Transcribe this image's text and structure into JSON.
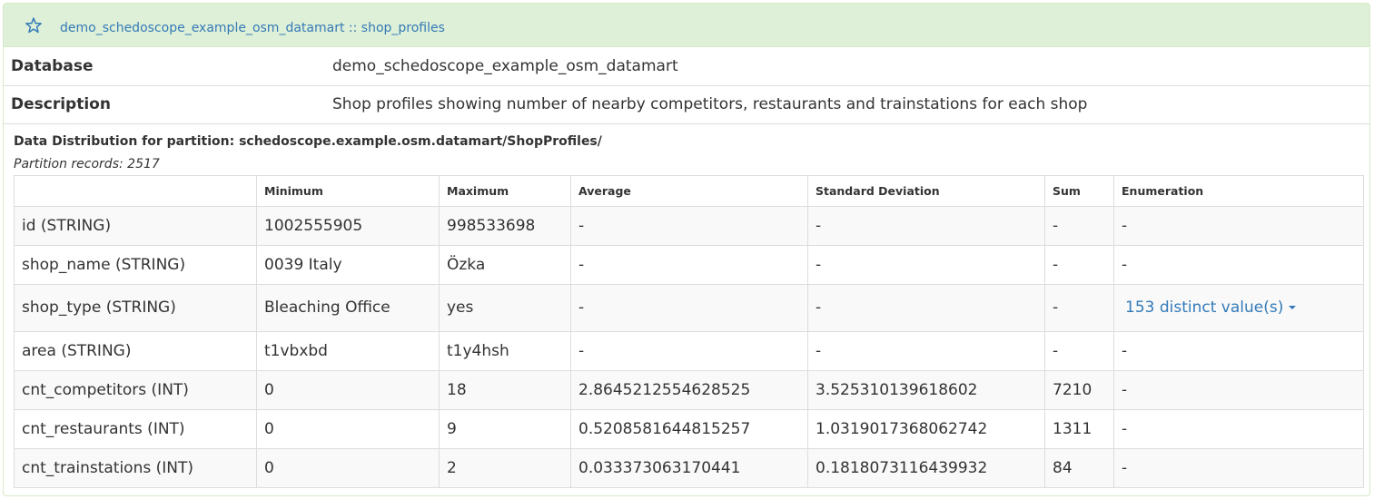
{
  "header": {
    "title": "demo_schedoscope_example_osm_datamart :: shop_profiles",
    "star_icon": "star-outline-icon",
    "accent_color": "#337ab7",
    "background_color": "#dff0d8"
  },
  "info": {
    "database_label": "Database",
    "database_value": "demo_schedoscope_example_osm_datamart",
    "description_label": "Description",
    "description_value": "Shop profiles showing number of nearby competitors, restaurants and trainstations for each shop"
  },
  "distribution": {
    "title": "Data Distribution for partition: schedoscope.example.osm.datamart/ShopProfiles/",
    "records": "Partition records: 2517",
    "columns": [
      "",
      "Minimum",
      "Maximum",
      "Average",
      "Standard Deviation",
      "Sum",
      "Enumeration"
    ],
    "rows": [
      {
        "field": "id (STRING)",
        "min": "1002555905",
        "max": "998533698",
        "avg": "-",
        "std": "-",
        "sum": "-",
        "enum": "-"
      },
      {
        "field": "shop_name (STRING)",
        "min": "0039 Italy",
        "max": "Özka",
        "avg": "-",
        "std": "-",
        "sum": "-",
        "enum": "-"
      },
      {
        "field": "shop_type (STRING)",
        "min": "Bleaching Office",
        "max": "yes",
        "avg": "-",
        "std": "-",
        "sum": "-",
        "enum_link": "153 distinct value(s)"
      },
      {
        "field": "area (STRING)",
        "min": "t1vbxbd",
        "max": "t1y4hsh",
        "avg": "-",
        "std": "-",
        "sum": "-",
        "enum": "-"
      },
      {
        "field": "cnt_competitors (INT)",
        "min": "0",
        "max": "18",
        "avg": "2.8645212554628525",
        "std": "3.525310139618602",
        "sum": "7210",
        "enum": "-"
      },
      {
        "field": "cnt_restaurants (INT)",
        "min": "0",
        "max": "9",
        "avg": "0.5208581644815257",
        "std": "1.0319017368062742",
        "sum": "1311",
        "enum": "-"
      },
      {
        "field": "cnt_trainstations (INT)",
        "min": "0",
        "max": "2",
        "avg": "0.033373063170441",
        "std": "0.1818073116439932",
        "sum": "84",
        "enum": "-"
      }
    ]
  }
}
